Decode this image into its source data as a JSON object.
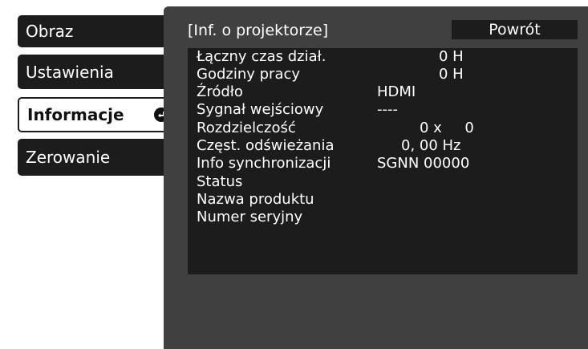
{
  "sidebar": {
    "items": [
      {
        "label": "Obraz"
      },
      {
        "label": "Ustawienia"
      },
      {
        "label": "Informacje"
      },
      {
        "label": "Zerowanie"
      }
    ]
  },
  "panel": {
    "title": "[Inf. o projektorze]",
    "back_label": "Powrót",
    "rows": [
      {
        "label": "Łączny czas dział.",
        "value": "0 H"
      },
      {
        "label": "Godziny pracy",
        "value": "0 H"
      },
      {
        "label": "Źródło",
        "value": "HDMI"
      },
      {
        "label": "Sygnał wejściowy",
        "value": "----"
      },
      {
        "label": "Rozdzielczość",
        "value": "0 x     0"
      },
      {
        "label": "Częst. odświeżania",
        "value": "0, 00 Hz"
      },
      {
        "label": "Info synchronizacji",
        "value": "SGNN 00000"
      },
      {
        "label": "Status",
        "value": ""
      },
      {
        "label": "Nazwa produktu",
        "value": ""
      },
      {
        "label": "Numer seryjny",
        "value": ""
      }
    ]
  },
  "colors": {
    "background": "#ffffff",
    "panel": "#404040",
    "menu_item": "#1c1c1c",
    "text": "#ffffff"
  },
  "icons": {
    "active_item_indicator": "return-arrow-icon"
  }
}
